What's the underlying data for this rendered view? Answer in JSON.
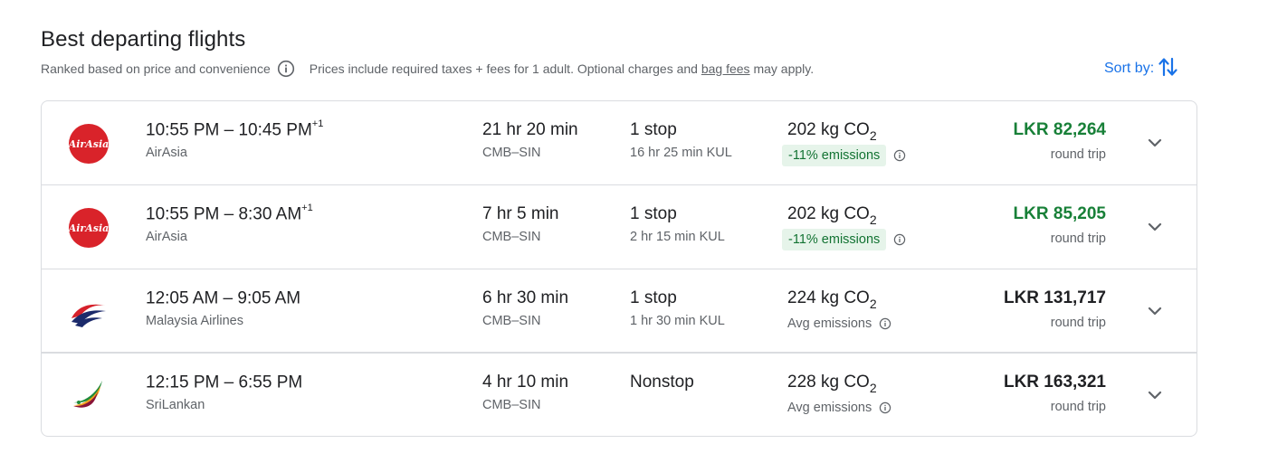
{
  "header": {
    "title": "Best departing flights",
    "ranked_text": "Ranked based on price and convenience",
    "prices_text": "Prices include required taxes + fees for 1 adult. Optional charges and ",
    "bag_fees_link": "bag fees",
    "prices_suffix": " may apply.",
    "sort_label": "Sort by:"
  },
  "colors": {
    "accent_blue": "#1a73e8",
    "price_green": "#188038",
    "badge_bg": "#e6f4ea",
    "badge_text": "#137333"
  },
  "flights": [
    {
      "logo": "airasia-logo",
      "depart": "10:55 PM",
      "dash": " – ",
      "arrive": "10:45 PM",
      "day_offset": "+1",
      "airline": "AirAsia",
      "duration": "21 hr 20 min",
      "route": "CMB–SIN",
      "stops": "1 stop",
      "layover": "16 hr 25 min KUL",
      "co2_value": "202 kg CO",
      "co2_sub": "2",
      "emissions": "-11% emissions",
      "emissions_style": "badge",
      "price": "LKR 82,264",
      "price_color": "green",
      "trip_type": "round trip"
    },
    {
      "logo": "airasia-logo",
      "depart": "10:55 PM",
      "dash": " – ",
      "arrive": "8:30 AM",
      "day_offset": "+1",
      "airline": "AirAsia",
      "duration": "7 hr 5 min",
      "route": "CMB–SIN",
      "stops": "1 stop",
      "layover": "2 hr 15 min KUL",
      "co2_value": "202 kg CO",
      "co2_sub": "2",
      "emissions": "-11% emissions",
      "emissions_style": "badge",
      "price": "LKR 85,205",
      "price_color": "green",
      "trip_type": "round trip"
    },
    {
      "logo": "malaysia-airlines-logo",
      "depart": "12:05 AM",
      "dash": " – ",
      "arrive": "9:05 AM",
      "day_offset": "",
      "airline": "Malaysia Airlines",
      "duration": "6 hr 30 min",
      "route": "CMB–SIN",
      "stops": "1 stop",
      "layover": "1 hr 30 min KUL",
      "co2_value": "224 kg CO",
      "co2_sub": "2",
      "emissions": "Avg emissions",
      "emissions_style": "plain",
      "price": "LKR 131,717",
      "price_color": "black",
      "trip_type": "round trip"
    },
    {
      "logo": "srilankan-logo",
      "depart": "12:15 PM",
      "dash": " – ",
      "arrive": "6:55 PM",
      "day_offset": "",
      "airline": "SriLankan",
      "duration": "4 hr 10 min",
      "route": "CMB–SIN",
      "stops": "Nonstop",
      "layover": "",
      "co2_value": "228 kg CO",
      "co2_sub": "2",
      "emissions": "Avg emissions",
      "emissions_style": "plain",
      "price": "LKR 163,321",
      "price_color": "black",
      "trip_type": "round trip"
    }
  ]
}
